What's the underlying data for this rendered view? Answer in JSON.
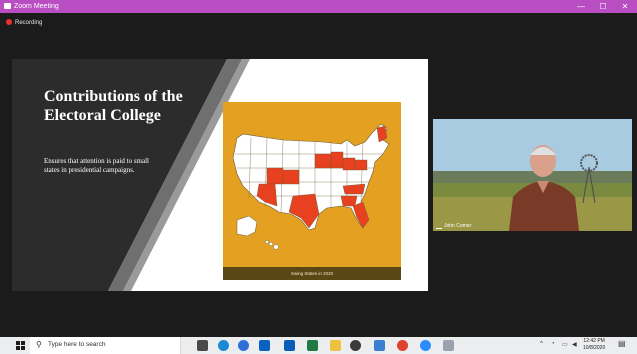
{
  "window": {
    "title": "Zoom Meeting",
    "minimize_glyph": "—",
    "maximize_glyph": "☐",
    "close_glyph": "✕"
  },
  "meeting": {
    "recording_label": "Recording"
  },
  "slide": {
    "title": "Contributions of the Electoral College",
    "subtitle": "Ensures that attention is paid to small states in presidential campaigns.",
    "map_caption": "Swing States in 2020"
  },
  "video": {
    "participant_name": "John Comer"
  },
  "taskbar": {
    "search_placeholder": "Type here to search",
    "time": "12:42 PM",
    "date": "10/8/2020",
    "apps": [
      "task-view",
      "edge",
      "chrome-alt",
      "mail",
      "outlook",
      "excel",
      "file-explorer",
      "chrome",
      "obs",
      "chrome-2",
      "zoom",
      "feather"
    ]
  },
  "colors": {
    "zoom_titlebar": "#b84ec2",
    "meeting_bg": "#1b1b1b",
    "map_background": "#e4a020",
    "swing_state": "#e8411f",
    "other_state": "#ffffff"
  }
}
